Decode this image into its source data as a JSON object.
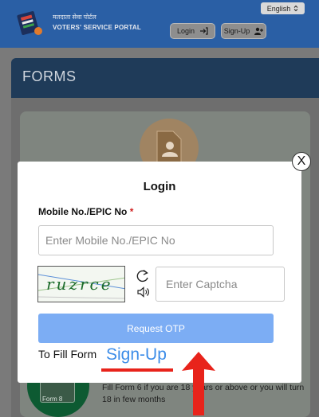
{
  "header": {
    "portal_name_hindi": "मतदाता सेवा पोर्टल",
    "portal_name_english": "VOTERS' SERVICE PORTAL",
    "language": "English",
    "login_label": "Login",
    "signup_label": "Sign-Up"
  },
  "forms": {
    "title": "FORMS",
    "form8_label": "Form 8",
    "card_text": "Fill Form 6 if you are 18 years or above or you will turn 18 in few months"
  },
  "modal": {
    "title": "Login",
    "field_label": "Mobile No./EPIC No",
    "required_mark": "*",
    "mobile_placeholder": "Enter Mobile No./EPIC No",
    "captcha_text": "ruzrce",
    "captcha_placeholder": "Enter Captcha",
    "request_otp_label": "Request OTP",
    "fill_form_text": "To Fill Form",
    "signup_link": "Sign-Up",
    "close_label": "X"
  },
  "icons": [
    "logo-icon",
    "chevron-updown-icon",
    "login-arrow-icon",
    "user-plus-icon",
    "refresh-icon",
    "speaker-icon",
    "document-add-icon",
    "arrow-up-icon"
  ],
  "colors": {
    "header_bg": "#2a5fa5",
    "button_blue": "#7cadf4",
    "link_blue": "#3d8de8",
    "annotation_red": "#e8231b"
  }
}
